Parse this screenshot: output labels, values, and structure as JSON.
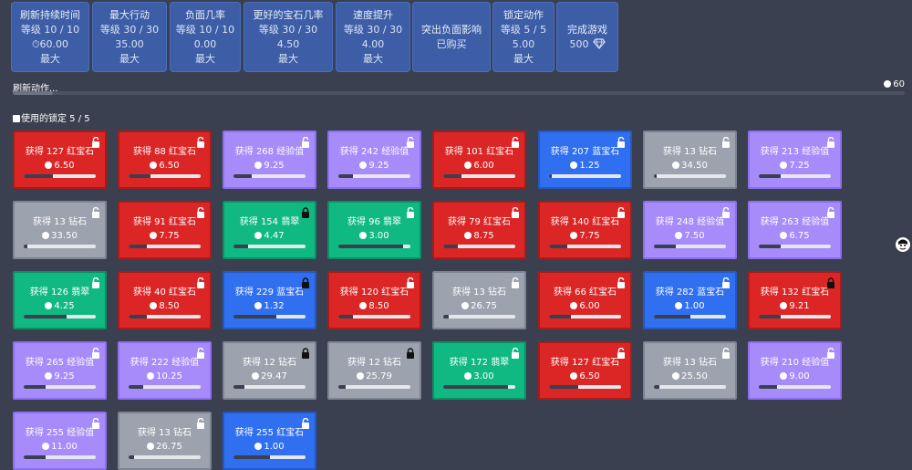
{
  "upgrades": [
    {
      "lines": [
        "刷新持续时间",
        "等级 10 / 10",
        "⏱60.00",
        "最大"
      ],
      "clock_line": 2
    },
    {
      "lines": [
        "最大行动",
        "等级 30 / 30",
        "35.00",
        "最大"
      ]
    },
    {
      "lines": [
        "负面几率",
        "等级 10 / 10",
        "0.00",
        "最大"
      ]
    },
    {
      "lines": [
        "更好的宝石几率",
        "等级 30 / 30",
        "4.50",
        "最大"
      ]
    },
    {
      "lines": [
        "速度提升",
        "等级 30 / 30",
        "4.00",
        "最大"
      ]
    },
    {
      "lines": [
        "突出负面影响",
        "已购买"
      ]
    },
    {
      "lines": [
        "锁定动作",
        "等级 5 / 5",
        "5.00",
        "最大"
      ]
    },
    {
      "lines": [
        "完成游戏",
        "500"
      ],
      "gem": true
    }
  ],
  "refresh": {
    "label": "刷新动作...",
    "value": "60",
    "progress": 0.045
  },
  "locks_used": "使用的锁定 5 / 5",
  "cards": [
    {
      "title": "获得 127 红宝石",
      "time": "6.50",
      "color": "red",
      "locked": false,
      "progress": 0.4
    },
    {
      "title": "获得 88 红宝石",
      "time": "6.50",
      "color": "red",
      "locked": false,
      "progress": 0.3
    },
    {
      "title": "获得 268 经验值",
      "time": "9.25",
      "color": "purple",
      "locked": false,
      "progress": 0.25
    },
    {
      "title": "获得 242 经验值",
      "time": "9.25",
      "color": "purple",
      "locked": false,
      "progress": 0.2
    },
    {
      "title": "获得 101 红宝石",
      "time": "6.00",
      "color": "red",
      "locked": false,
      "progress": 0.25
    },
    {
      "title": "获得 207 蓝宝石",
      "time": "1.25",
      "color": "blue",
      "locked": false,
      "progress": 0.04
    },
    {
      "title": "获得 13 钻石",
      "time": "34.50",
      "color": "gray",
      "locked": false,
      "progress": 0.04
    },
    {
      "title": "获得 213 经验值",
      "time": "7.25",
      "color": "purple",
      "locked": false,
      "progress": 0.3
    },
    {
      "title": "获得 13 钻石",
      "time": "33.50",
      "color": "gray",
      "locked": false,
      "progress": 0.05
    },
    {
      "title": "获得 91 红宝石",
      "time": "7.75",
      "color": "red",
      "locked": false,
      "progress": 0.25
    },
    {
      "title": "获得 154 翡翠",
      "time": "4.47",
      "color": "green",
      "locked": true,
      "progress": 0.2
    },
    {
      "title": "获得 96 翡翠",
      "time": "3.00",
      "color": "green",
      "locked": false,
      "progress": 0.9
    },
    {
      "title": "获得 79 红宝石",
      "time": "8.75",
      "color": "red",
      "locked": false,
      "progress": 0.2
    },
    {
      "title": "获得 140 红宝石",
      "time": "7.75",
      "color": "red",
      "locked": false,
      "progress": 0.25
    },
    {
      "title": "获得 248 经验值",
      "time": "7.50",
      "color": "purple",
      "locked": false,
      "progress": 0.3
    },
    {
      "title": "获得 263 经验值",
      "time": "6.75",
      "color": "purple",
      "locked": false,
      "progress": 0.3
    },
    {
      "title": "获得 126 翡翠",
      "time": "4.25",
      "color": "green",
      "locked": false,
      "progress": 0.6
    },
    {
      "title": "获得 40 红宝石",
      "time": "8.50",
      "color": "red",
      "locked": false,
      "progress": 0.25
    },
    {
      "title": "获得 229 蓝宝石",
      "time": "1.32",
      "color": "blue",
      "locked": true,
      "progress": 0.6
    },
    {
      "title": "获得 120 红宝石",
      "time": "8.50",
      "color": "red",
      "locked": false,
      "progress": 0.2
    },
    {
      "title": "获得 13 钻石",
      "time": "26.75",
      "color": "gray",
      "locked": false,
      "progress": 0.08
    },
    {
      "title": "获得 66 红宝石",
      "time": "6.00",
      "color": "red",
      "locked": false,
      "progress": 0.3
    },
    {
      "title": "获得 282 蓝宝石",
      "time": "1.00",
      "color": "blue",
      "locked": false,
      "progress": 0.5
    },
    {
      "title": "获得 132 红宝石",
      "time": "9.21",
      "color": "red",
      "locked": true,
      "progress": 0.3
    },
    {
      "title": "获得 265 经验值",
      "time": "9.25",
      "color": "purple",
      "locked": false,
      "progress": 0.3
    },
    {
      "title": "获得 222 经验值",
      "time": "10.25",
      "color": "purple",
      "locked": false,
      "progress": 0.2
    },
    {
      "title": "获得 12 钻石",
      "time": "29.47",
      "color": "gray",
      "locked": true,
      "progress": 0.15
    },
    {
      "title": "获得 12 钻石",
      "time": "25.79",
      "color": "gray",
      "locked": true,
      "progress": 0.1
    },
    {
      "title": "获得 172 翡翠",
      "time": "3.00",
      "color": "green",
      "locked": false,
      "progress": 0.9
    },
    {
      "title": "获得 127 红宝石",
      "time": "6.50",
      "color": "red",
      "locked": false,
      "progress": 0.4
    },
    {
      "title": "获得 13 钻石",
      "time": "25.50",
      "color": "gray",
      "locked": false,
      "progress": 0.08
    },
    {
      "title": "获得 210 经验值",
      "time": "9.00",
      "color": "purple",
      "locked": false,
      "progress": 0.25
    },
    {
      "title": "获得 255 经验值",
      "time": "11.00",
      "color": "purple",
      "locked": false,
      "progress": 0.3
    },
    {
      "title": "获得 13 钻石",
      "time": "26.75",
      "color": "gray",
      "locked": false,
      "progress": 0.08
    },
    {
      "title": "获得 255 红宝石",
      "time": "1.00",
      "color": "blue",
      "locked": false,
      "progress": 0.5
    }
  ]
}
